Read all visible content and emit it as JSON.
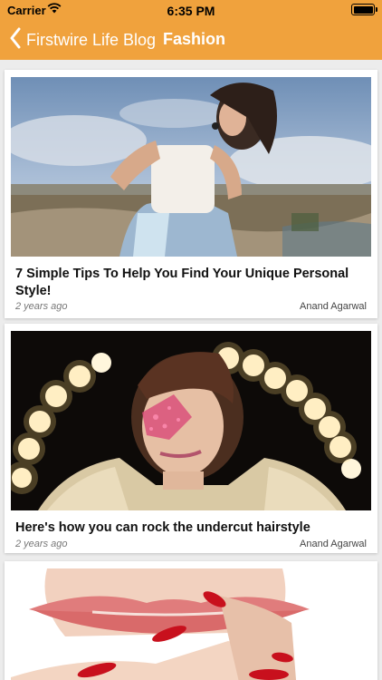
{
  "status_bar": {
    "carrier": "Carrier",
    "time": "6:35 PM"
  },
  "nav": {
    "back_label": "Firstwire Life Blog",
    "title": "Fashion"
  },
  "colors": {
    "header": "#f0a23d",
    "background": "#ececec"
  },
  "articles": [
    {
      "title": "7 Simple Tips To Help You Find Your Unique Personal Style!",
      "date": "2 years ago",
      "author": "Anand Agarwal"
    },
    {
      "title": "Here's how you can rock the undercut hairstyle",
      "date": "2 years ago",
      "author": "Anand Agarwal"
    },
    {
      "title": "",
      "date": "",
      "author": ""
    }
  ]
}
